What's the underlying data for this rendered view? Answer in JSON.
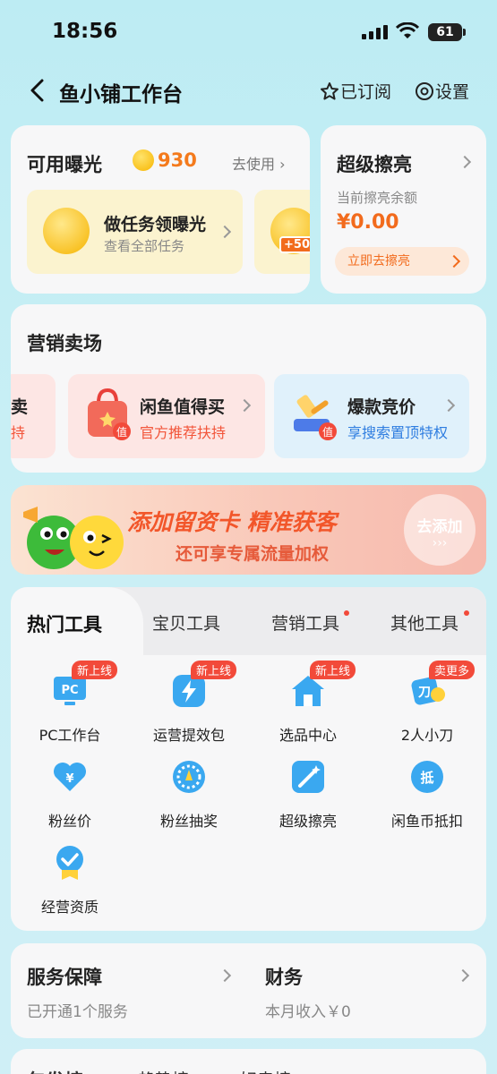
{
  "status": {
    "time": "18:56",
    "battery": "61"
  },
  "nav": {
    "title": "鱼小铺工作台",
    "subscribed": "已订阅",
    "settings": "设置"
  },
  "exposure": {
    "title": "可用曝光",
    "count": "930",
    "use": "去使用",
    "task_title": "做任务领曝光",
    "task_sub": "查看全部任务",
    "bonus": "+50"
  },
  "polish": {
    "title": "超级擦亮",
    "balance_label": "当前擦亮余额",
    "balance": "¥0.00",
    "button": "立即去擦亮"
  },
  "marketing": {
    "title": "营销卖场",
    "items": [
      {
        "title": "卖",
        "sub": "持"
      },
      {
        "title": "闲鱼值得买",
        "sub": "官方推荐扶持",
        "badge": "值"
      },
      {
        "title": "爆款竞价",
        "sub": "享搜索置顶特权",
        "badge": "值"
      }
    ]
  },
  "banner": {
    "line1": "添加留资卡 精准获客",
    "line2": "还可享专属流量加权",
    "button": "去添加",
    "arrows": "›››"
  },
  "tools": {
    "tabs": [
      "热门工具",
      "宝贝工具",
      "营销工具",
      "其他工具"
    ],
    "items": [
      {
        "label": "PC工作台",
        "tag": "新上线",
        "icon": "pc-workbench-icon"
      },
      {
        "label": "运营提效包",
        "tag": "新上线",
        "icon": "efficiency-pack-icon"
      },
      {
        "label": "选品中心",
        "tag": "新上线",
        "icon": "selection-center-icon"
      },
      {
        "label": "2人小刀",
        "tag": "卖更多",
        "icon": "knife-icon"
      },
      {
        "label": "粉丝价",
        "tag": "",
        "icon": "fan-price-icon"
      },
      {
        "label": "粉丝抽奖",
        "tag": "",
        "icon": "fan-lottery-icon"
      },
      {
        "label": "超级擦亮",
        "tag": "",
        "icon": "super-polish-icon"
      },
      {
        "label": "闲鱼币抵扣",
        "tag": "",
        "icon": "coin-deduct-icon"
      },
      {
        "label": "经营资质",
        "tag": "",
        "icon": "qualification-icon"
      }
    ],
    "icon_glyphs": {
      "pc": "PC",
      "yen": "¥",
      "knife": "刀",
      "di": "抵"
    }
  },
  "service": {
    "title": "服务保障",
    "sub": "已开通1个服务"
  },
  "finance": {
    "title": "财务",
    "sub": "本月收入￥0"
  },
  "bottom_tabs": [
    "包发榜",
    "趋势榜",
    "好卖榜"
  ],
  "colors": {
    "accent": "#f26b1d",
    "red": "#f24a3a",
    "blue": "#2e7de0"
  }
}
